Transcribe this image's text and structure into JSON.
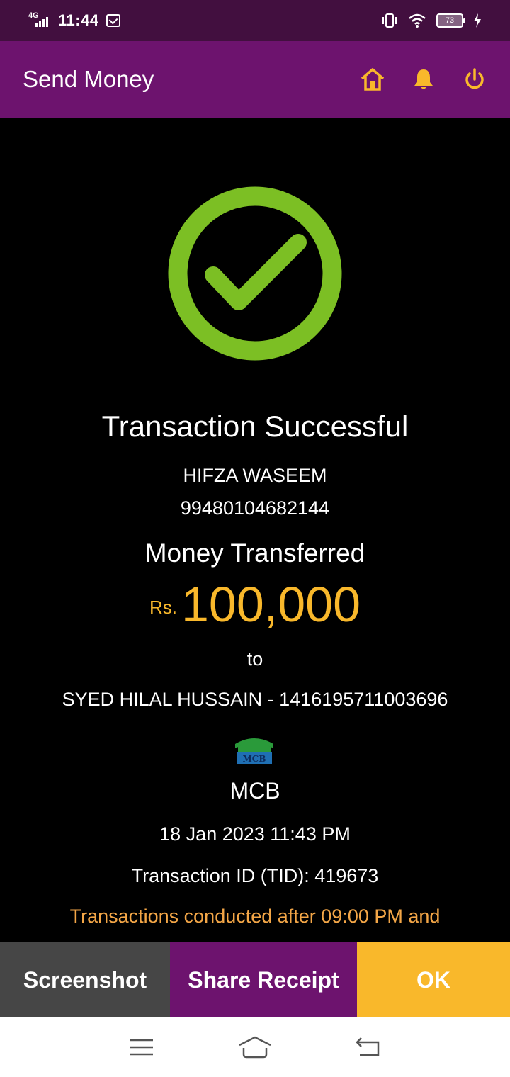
{
  "status_bar": {
    "network": "4G",
    "time": "11:44",
    "battery": "73"
  },
  "app_bar": {
    "title": "Send Money",
    "icons": [
      "home-icon",
      "bell-icon",
      "power-icon"
    ]
  },
  "receipt": {
    "status_title": "Transaction Successful",
    "sender_name": "HIFZA WASEEM",
    "sender_account": "99480104682144",
    "money_label": "Money Transferred",
    "currency": "Rs.",
    "amount": "100,000",
    "to_label": "to",
    "recipient": "SYED HILAL HUSSAIN - 1416195711003696",
    "bank_logo_text": "MCB",
    "bank_name": "MCB",
    "datetime": "18 Jan 2023 11:43 PM",
    "transaction_id": "Transaction ID (TID): 419673",
    "notice": "Transactions conducted after 09:00 PM and"
  },
  "actions": {
    "screenshot_label": "Screenshot",
    "share_label": "Share Receipt",
    "ok_label": "OK"
  },
  "colors": {
    "status_bar": "#420f3f",
    "app_bar": "#6d136e",
    "accent": "#f9b82b",
    "success": "#7cbf24",
    "notice": "#f3a647",
    "screenshot_button": "#464646"
  }
}
